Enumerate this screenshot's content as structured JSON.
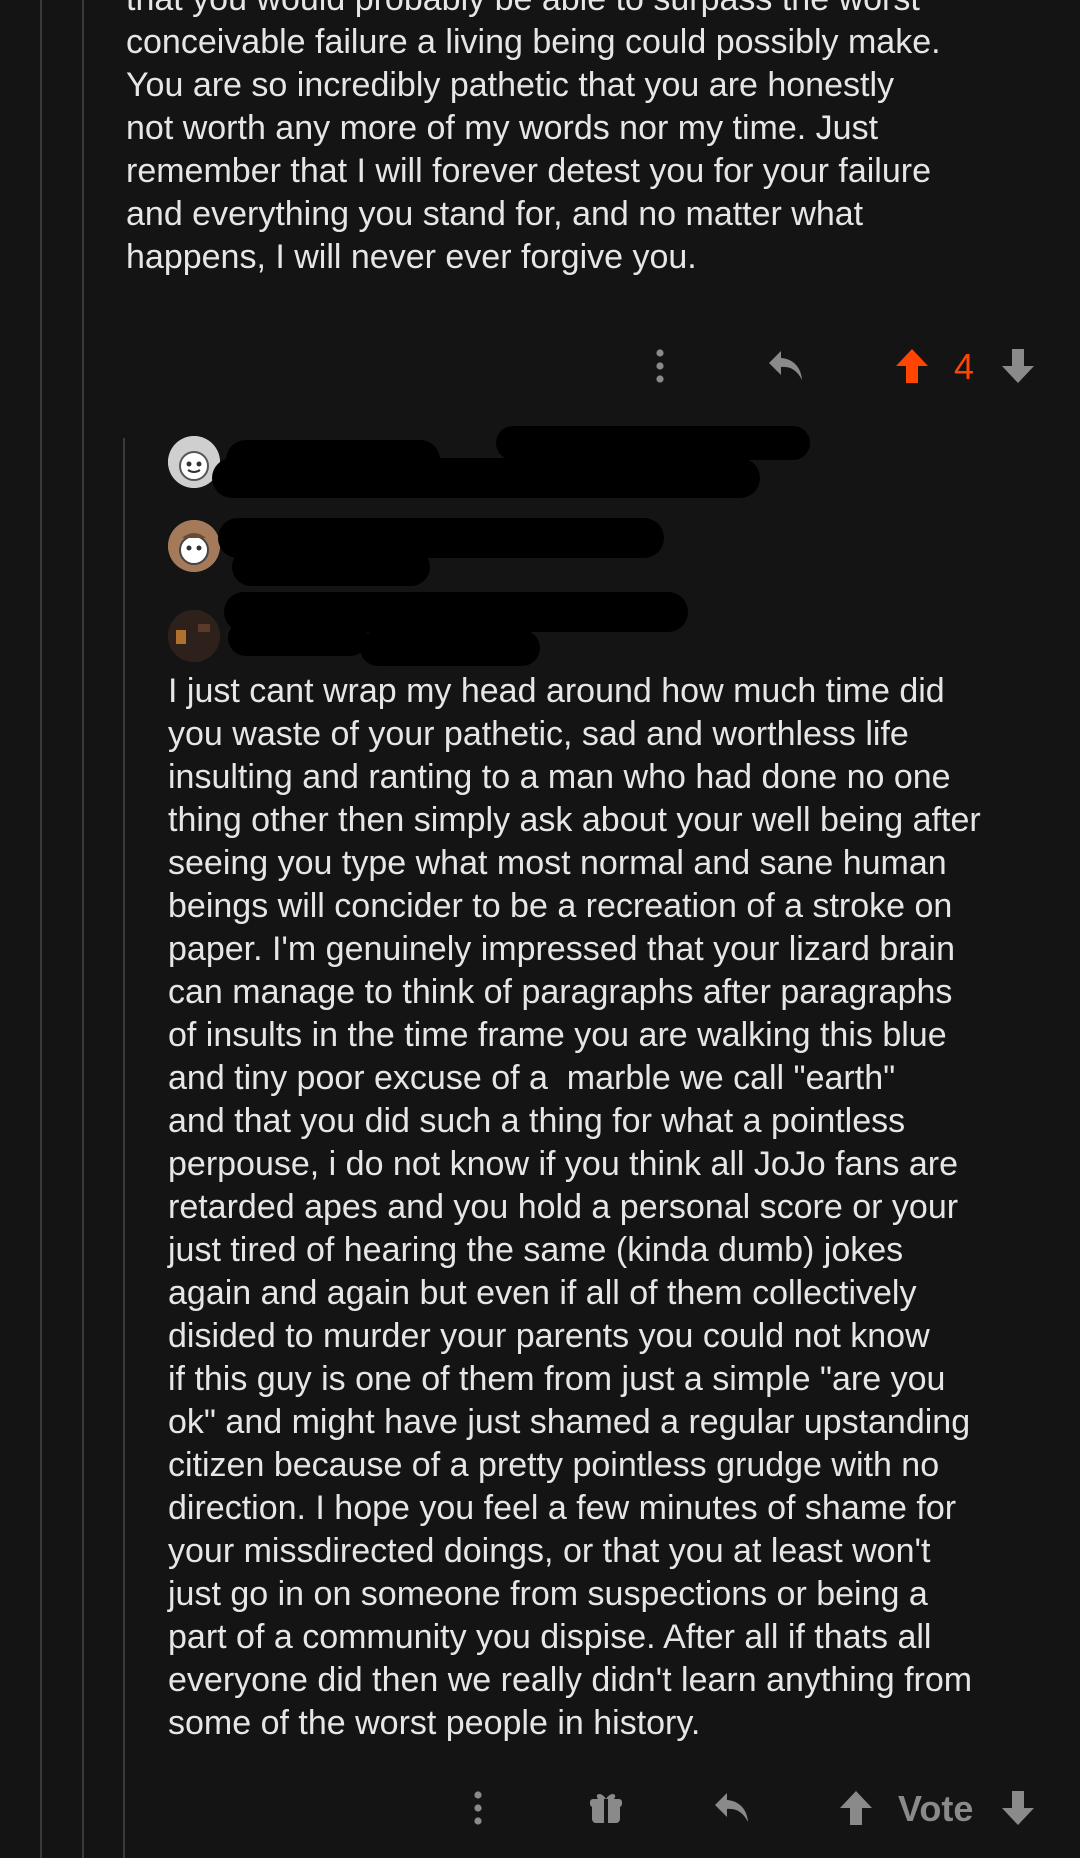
{
  "top_comment": {
    "body": "that you would probably be able to surpass the worst\nconceivable failure a living being could possibly make.\nYou are so incredibly pathetic that you are honestly\nnot worth any more of my words nor my time. Just\nremember that I will forever detest you for your failure\nand everything you stand for, and no matter what\nhappens, I will never ever forgive you.",
    "vote_count": "4",
    "upvote_color": "#ff4500"
  },
  "reply_comment": {
    "body": "I just cant wrap my head around how much time did\nyou waste of your pathetic, sad and worthless life\ninsulting and ranting to a man who had done no one\nthing other then simply ask about your well being after\nseeing you type what most normal and sane human\nbeings will concider to be a recreation of a stroke on\npaper. I'm genuinely impressed that your lizard brain\ncan manage to think of paragraphs after paragraphs\nof insults in the time frame you are walking this blue\nand tiny poor excuse of a  marble we call \"earth\"\nand that you did such a thing for what a pointless\nperpouse, i do not know if you think all JoJo fans are\nretarded apes and you hold a personal score or your\njust tired of hearing the same (kinda dumb) jokes\nagain and again but even if all of them collectively\ndisided to murder your parents you could not know\nif this guy is one of them from just a simple \"are you\nok\" and might have just shamed a regular upstanding\ncitizen because of a pretty pointless grudge with no\ndirection. I hope you feel a few minutes of shame for\nyour missdirected doings, or that you at least won't\njust go in on someone from suspections or being a\npart of a community you dispise. After all if thats all\neveryone did then we really didn't learn anything from\nsome of the worst people in history.",
    "vote_label": "Vote"
  },
  "icons": {
    "more": "more-vertical-icon",
    "reply": "reply-icon",
    "upvote": "upvote-arrow-icon",
    "downvote": "downvote-arrow-icon",
    "award": "gift-award-icon",
    "avatar": "snoo-avatar-icon"
  },
  "colors": {
    "background": "#141414",
    "text": "#e6e6e6",
    "muted_icon": "#8a8a8a",
    "accent": "#ff4500"
  }
}
